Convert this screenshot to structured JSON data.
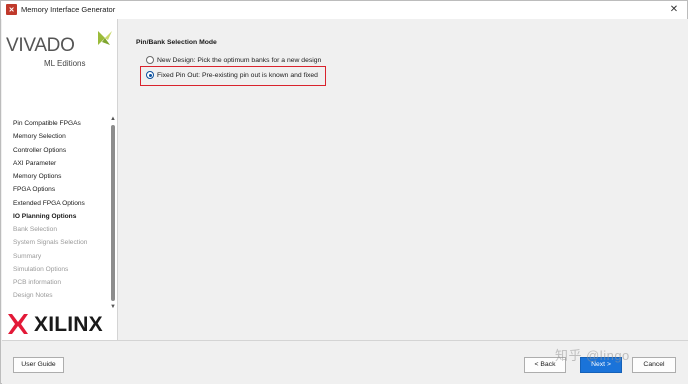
{
  "window": {
    "title": "Memory Interface Generator",
    "close_glyph": "✕"
  },
  "sidebar": {
    "logo_main": "VIVADO",
    "logo_edition": "ML Editions",
    "logo_company": "XILINX",
    "steps": [
      {
        "label": "Pin Compatible FPGAs",
        "state": "done"
      },
      {
        "label": "Memory Selection",
        "state": "done"
      },
      {
        "label": "Controller Options",
        "state": "done"
      },
      {
        "label": "AXI Parameter",
        "state": "done"
      },
      {
        "label": "Memory Options",
        "state": "done"
      },
      {
        "label": "FPGA Options",
        "state": "done"
      },
      {
        "label": "Extended FPGA Options",
        "state": "done"
      },
      {
        "label": "IO Planning Options",
        "state": "current"
      },
      {
        "label": "Bank Selection",
        "state": "disabled"
      },
      {
        "label": "System Signals Selection",
        "state": "disabled"
      },
      {
        "label": "Summary",
        "state": "disabled"
      },
      {
        "label": "Simulation Options",
        "state": "disabled"
      },
      {
        "label": "PCB information",
        "state": "disabled"
      },
      {
        "label": "Design Notes",
        "state": "disabled"
      }
    ]
  },
  "main": {
    "group_title": "Pin/Bank Selection Mode",
    "options": [
      {
        "label": "New Design: Pick the optimum banks for a new design",
        "selected": false
      },
      {
        "label": "Fixed Pin Out: Pre-existing pin out is known and fixed",
        "selected": true
      }
    ]
  },
  "footer": {
    "user_guide": "User Guide",
    "back": "< Back",
    "next": "Next >",
    "cancel": "Cancel"
  },
  "watermark": "知乎 @lingo",
  "colors": {
    "accent": "#1a73d9",
    "highlight": "#d9232d",
    "radio_selected": "#0a4f9e"
  }
}
